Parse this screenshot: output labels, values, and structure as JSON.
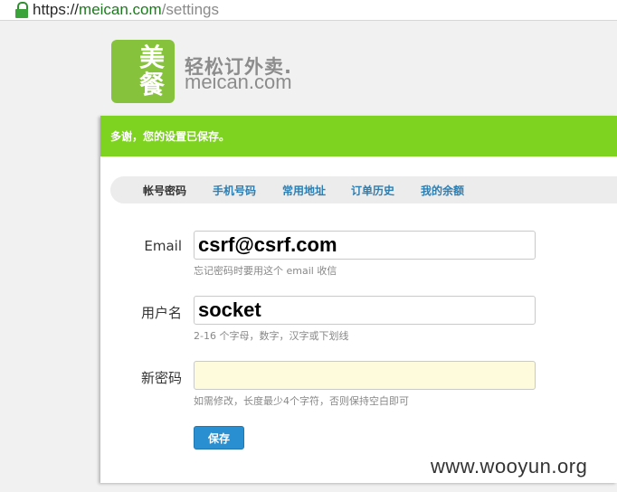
{
  "browser": {
    "url_scheme": "https://",
    "url_host": "meican.com",
    "url_path": "/settings"
  },
  "logo": {
    "char1": "美",
    "char2": "餐",
    "slogan": "轻松订外卖.",
    "domain": "meican.com",
    "color": "#86c23c"
  },
  "notice": {
    "text": "多谢，您的设置已保存。",
    "color": "#7ed321"
  },
  "tabs": [
    {
      "label": "帐号密码",
      "active": true
    },
    {
      "label": "手机号码",
      "active": false
    },
    {
      "label": "常用地址",
      "active": false
    },
    {
      "label": "订单历史",
      "active": false
    },
    {
      "label": "我的余额",
      "active": false
    }
  ],
  "form": {
    "email": {
      "label": "Email",
      "value": "csrf@csrf.com",
      "hint": "忘记密码时要用这个 email 收信"
    },
    "username": {
      "label": "用户名",
      "value": "socket",
      "hint": "2-16 个字母，数字，汉字或下划线"
    },
    "password": {
      "label": "新密码",
      "value": "",
      "hint": "如需修改，长度最少4个字符，否则保持空白即可"
    },
    "save_label": "保存"
  },
  "watermark": "www.wooyun.org"
}
